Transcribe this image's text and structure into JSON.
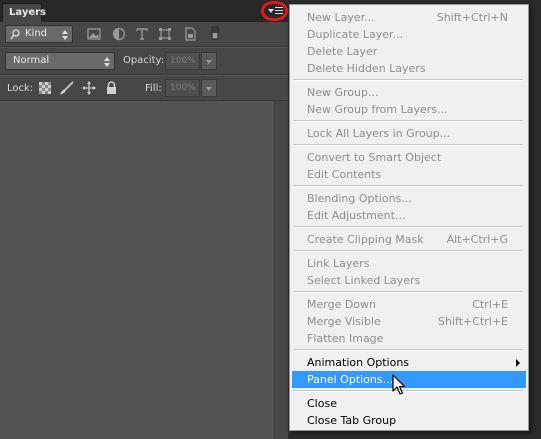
{
  "panel": {
    "tab_label": "Layers",
    "tab_close": "»",
    "filter_kind": "Kind",
    "blend_mode": "Normal",
    "opacity_label": "Opacity:",
    "opacity_value": "100%",
    "lock_label": "Lock:",
    "fill_label": "Fill:",
    "fill_value": "100%"
  },
  "menu": {
    "items": [
      {
        "label": "New Layer...",
        "shortcut": "Shift+Ctrl+N",
        "enabled": false
      },
      {
        "label": "Duplicate Layer...",
        "shortcut": "",
        "enabled": false
      },
      {
        "label": "Delete Layer",
        "shortcut": "",
        "enabled": false
      },
      {
        "label": "Delete Hidden Layers",
        "shortcut": "",
        "enabled": false
      },
      {
        "label": "New Group...",
        "shortcut": "",
        "enabled": false
      },
      {
        "label": "New Group from Layers...",
        "shortcut": "",
        "enabled": false
      },
      {
        "label": "Lock All Layers in Group...",
        "shortcut": "",
        "enabled": false
      },
      {
        "label": "Convert to Smart Object",
        "shortcut": "",
        "enabled": false
      },
      {
        "label": "Edit Contents",
        "shortcut": "",
        "enabled": false
      },
      {
        "label": "Blending Options...",
        "shortcut": "",
        "enabled": false
      },
      {
        "label": "Edit Adjustment...",
        "shortcut": "",
        "enabled": false
      },
      {
        "label": "Create Clipping Mask",
        "shortcut": "Alt+Ctrl+G",
        "enabled": false
      },
      {
        "label": "Link Layers",
        "shortcut": "",
        "enabled": false
      },
      {
        "label": "Select Linked Layers",
        "shortcut": "",
        "enabled": false
      },
      {
        "label": "Merge Down",
        "shortcut": "Ctrl+E",
        "enabled": false
      },
      {
        "label": "Merge Visible",
        "shortcut": "Shift+Ctrl+E",
        "enabled": false
      },
      {
        "label": "Flatten Image",
        "shortcut": "",
        "enabled": false
      },
      {
        "label": "Animation Options",
        "shortcut": "",
        "enabled": true,
        "submenu": true
      },
      {
        "label": "Panel Options...",
        "shortcut": "",
        "enabled": true,
        "highlighted": true
      },
      {
        "label": "Close",
        "shortcut": "",
        "enabled": true
      },
      {
        "label": "Close Tab Group",
        "shortcut": "",
        "enabled": true
      }
    ]
  },
  "colors": {
    "highlight": "#3399ff",
    "annotation_circle": "#e5151c",
    "panel_bg": "#474747"
  },
  "icons": [
    "search-icon",
    "pixel-filter-icon",
    "adjustment-filter-icon",
    "type-filter-icon",
    "shape-filter-icon",
    "smart-object-filter-icon",
    "filter-toggle-icon",
    "lock-transparency-icon",
    "lock-image-icon",
    "lock-position-icon",
    "lock-all-icon",
    "panel-menu-icon",
    "mouse-pointer-icon"
  ]
}
